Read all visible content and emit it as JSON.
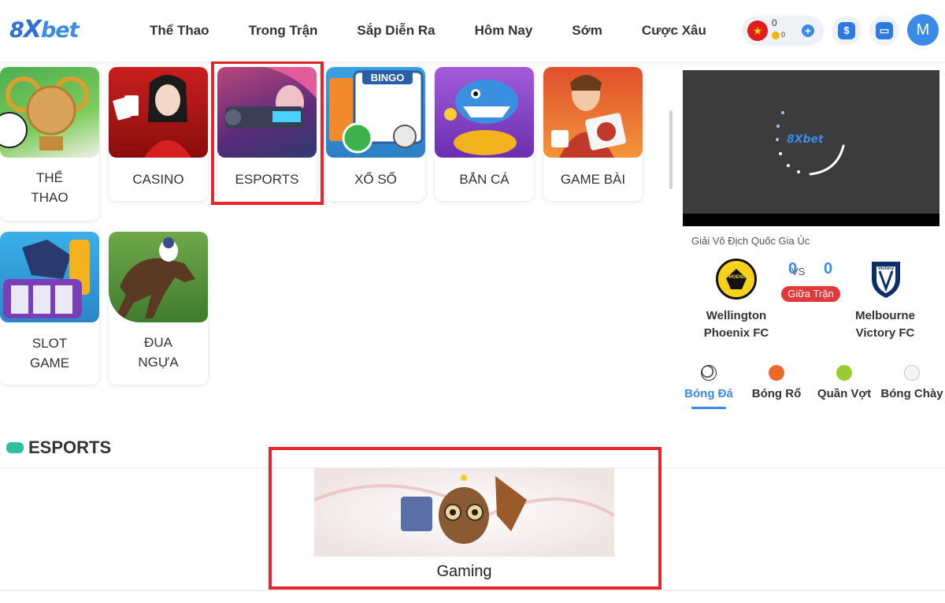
{
  "header": {
    "logo": {
      "num": "8",
      "x": "X",
      "bet": "bet"
    },
    "nav": [
      "Thể Thao",
      "Trong Trận",
      "Sắp Diễn Ra",
      "Hôm Nay",
      "Sớm",
      "Cược Xâu"
    ],
    "wallet": {
      "balance": "0",
      "coins": "0",
      "flag": "★"
    },
    "avatar_letter": "M",
    "deposit_icon": "$",
    "card_icon": "▭"
  },
  "games": [
    {
      "label1": "THỂ",
      "label2": "THAO"
    },
    {
      "label1": "CASINO",
      "label2": ""
    },
    {
      "label1": "ESPORTS",
      "label2": ""
    },
    {
      "label1": "XỔ SỐ",
      "label2": ""
    },
    {
      "label1": "BẮN CÁ",
      "label2": ""
    },
    {
      "label1": "GAME BÀI",
      "label2": ""
    },
    {
      "label1": "SLOT",
      "label2": "GAME"
    },
    {
      "label1": "ĐUA",
      "label2": "NGỰA"
    }
  ],
  "bingo_text": "BINGO",
  "video": {
    "logo": "8Xbet"
  },
  "match": {
    "league": "Giải Vô Địch Quốc Gia Úc",
    "home_score": "0",
    "vs": "VS",
    "away_score": "0",
    "status": "Giữa Trận",
    "home_line1": "Wellington",
    "home_line2": "Phoenix FC",
    "away_line1": "Melbourne",
    "away_line2": "Victory FC",
    "home_logo_text": "PHOENIX",
    "away_logo_text": "Victory"
  },
  "sports_tabs": [
    "Bóng Đá",
    "Bóng Rổ",
    "Quần Vợt",
    "Bóng Chày"
  ],
  "esports": {
    "title": "ESPORTS",
    "banner_label": "Gaming"
  },
  "colors": {
    "accent": "#3a8ae8",
    "highlight": "#e6262a",
    "live": "#e23a3a"
  }
}
